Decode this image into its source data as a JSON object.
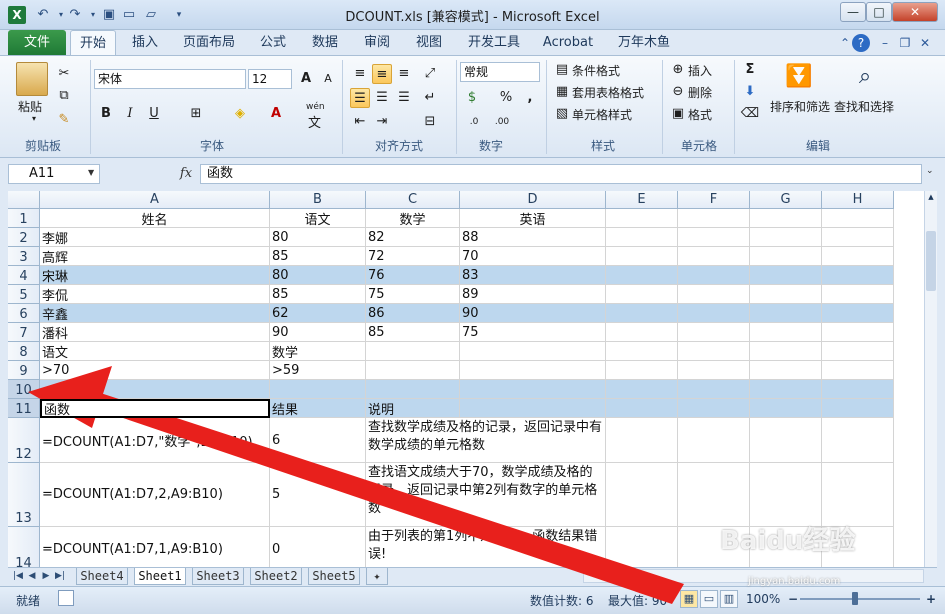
{
  "window": {
    "title": "DCOUNT.xls  [兼容模式] - Microsoft Excel",
    "app_icon": "X",
    "minimize": "—",
    "maximize": "□",
    "close": "✕"
  },
  "ribbon_tabs": {
    "file": "文件",
    "items": [
      "开始",
      "插入",
      "页面布局",
      "公式",
      "数据",
      "审阅",
      "视图",
      "开发工具",
      "Acrobat",
      "万年木鱼"
    ]
  },
  "ribbon": {
    "clipboard": {
      "paste": "粘贴",
      "group": "剪贴板"
    },
    "font": {
      "name": "宋体",
      "size": "12",
      "bold": "B",
      "italic": "I",
      "underline": "U",
      "group": "字体",
      "wen": "wén",
      "wen_char": "文"
    },
    "alignment": {
      "group": "对齐方式"
    },
    "number": {
      "format": "常规",
      "percent": "%",
      "comma": ",",
      "group": "数字"
    },
    "styles": {
      "conditional": "条件格式",
      "table": "套用表格格式",
      "cell": "单元格样式",
      "group": "样式"
    },
    "cells": {
      "insert": "插入",
      "delete": "删除",
      "format": "格式",
      "group": "单元格"
    },
    "editing": {
      "sort": "排序和筛选",
      "find": "查找和选择",
      "group": "编辑",
      "sigma": "Σ"
    }
  },
  "formula_bar": {
    "name_box": "A11",
    "fx": "fx",
    "content": "函数"
  },
  "columns": [
    "A",
    "B",
    "C",
    "D",
    "E",
    "F",
    "G",
    "H"
  ],
  "rows": [
    {
      "num": "1",
      "cells": [
        "姓名",
        "语文",
        "数学",
        "英语"
      ],
      "center": true
    },
    {
      "num": "2",
      "cells": [
        "李娜",
        "80",
        "82",
        "88"
      ]
    },
    {
      "num": "3",
      "cells": [
        "高辉",
        "85",
        "72",
        "70"
      ]
    },
    {
      "num": "4",
      "cells": [
        "宋琳",
        "80",
        "76",
        "83"
      ],
      "highlight": true
    },
    {
      "num": "5",
      "cells": [
        "李侃",
        "85",
        "75",
        "89"
      ]
    },
    {
      "num": "6",
      "cells": [
        "辛鑫",
        "62",
        "86",
        "90"
      ],
      "highlight": true
    },
    {
      "num": "7",
      "cells": [
        "潘科",
        "90",
        "85",
        "75"
      ]
    },
    {
      "num": "8",
      "cells": [
        "语文",
        "数学",
        "",
        ""
      ]
    },
    {
      "num": "9",
      "cells": [
        ">70",
        ">59",
        "",
        ""
      ]
    },
    {
      "num": "10",
      "cells": [
        "",
        "",
        "",
        ""
      ],
      "highlight": true
    },
    {
      "num": "11",
      "cells": [
        "函数",
        "结果",
        "说明",
        ""
      ],
      "highlight": true
    },
    {
      "num": "12",
      "cells": [
        "=DCOUNT(A1:D7,\"数学\",B9:B10)",
        "6",
        "查找数学成绩及格的记录，返回记录中有数学成绩的单元格数",
        ""
      ]
    },
    {
      "num": "13",
      "cells": [
        "=DCOUNT(A1:D7,2,A9:B10)",
        "5",
        "查找语文成绩大于70，数学成绩及格的记录，返回记录中第2列有数字的单元格数",
        ""
      ]
    },
    {
      "num": "14",
      "cells": [
        "=DCOUNT(A1:D7,1,A9:B10)",
        "0",
        "由于列表的第1列不是数字，函数结果错误!",
        ""
      ]
    }
  ],
  "sheet_tabs": [
    "Sheet4",
    "Sheet1",
    "Sheet3",
    "Sheet2",
    "Sheet5"
  ],
  "status_bar": {
    "ready": "就绪",
    "count": "数值计数: 6",
    "max": "最大值: 90",
    "zoom": "100%",
    "zoom_out": "−",
    "zoom_in": "+"
  },
  "watermark": {
    "brand": "Baidu经验",
    "url": "jingyan.baidu.com"
  },
  "colors": {
    "file_tab": "#1f7a36",
    "highlight_row": "#bdd7ee",
    "arrow": "#e8201c"
  }
}
